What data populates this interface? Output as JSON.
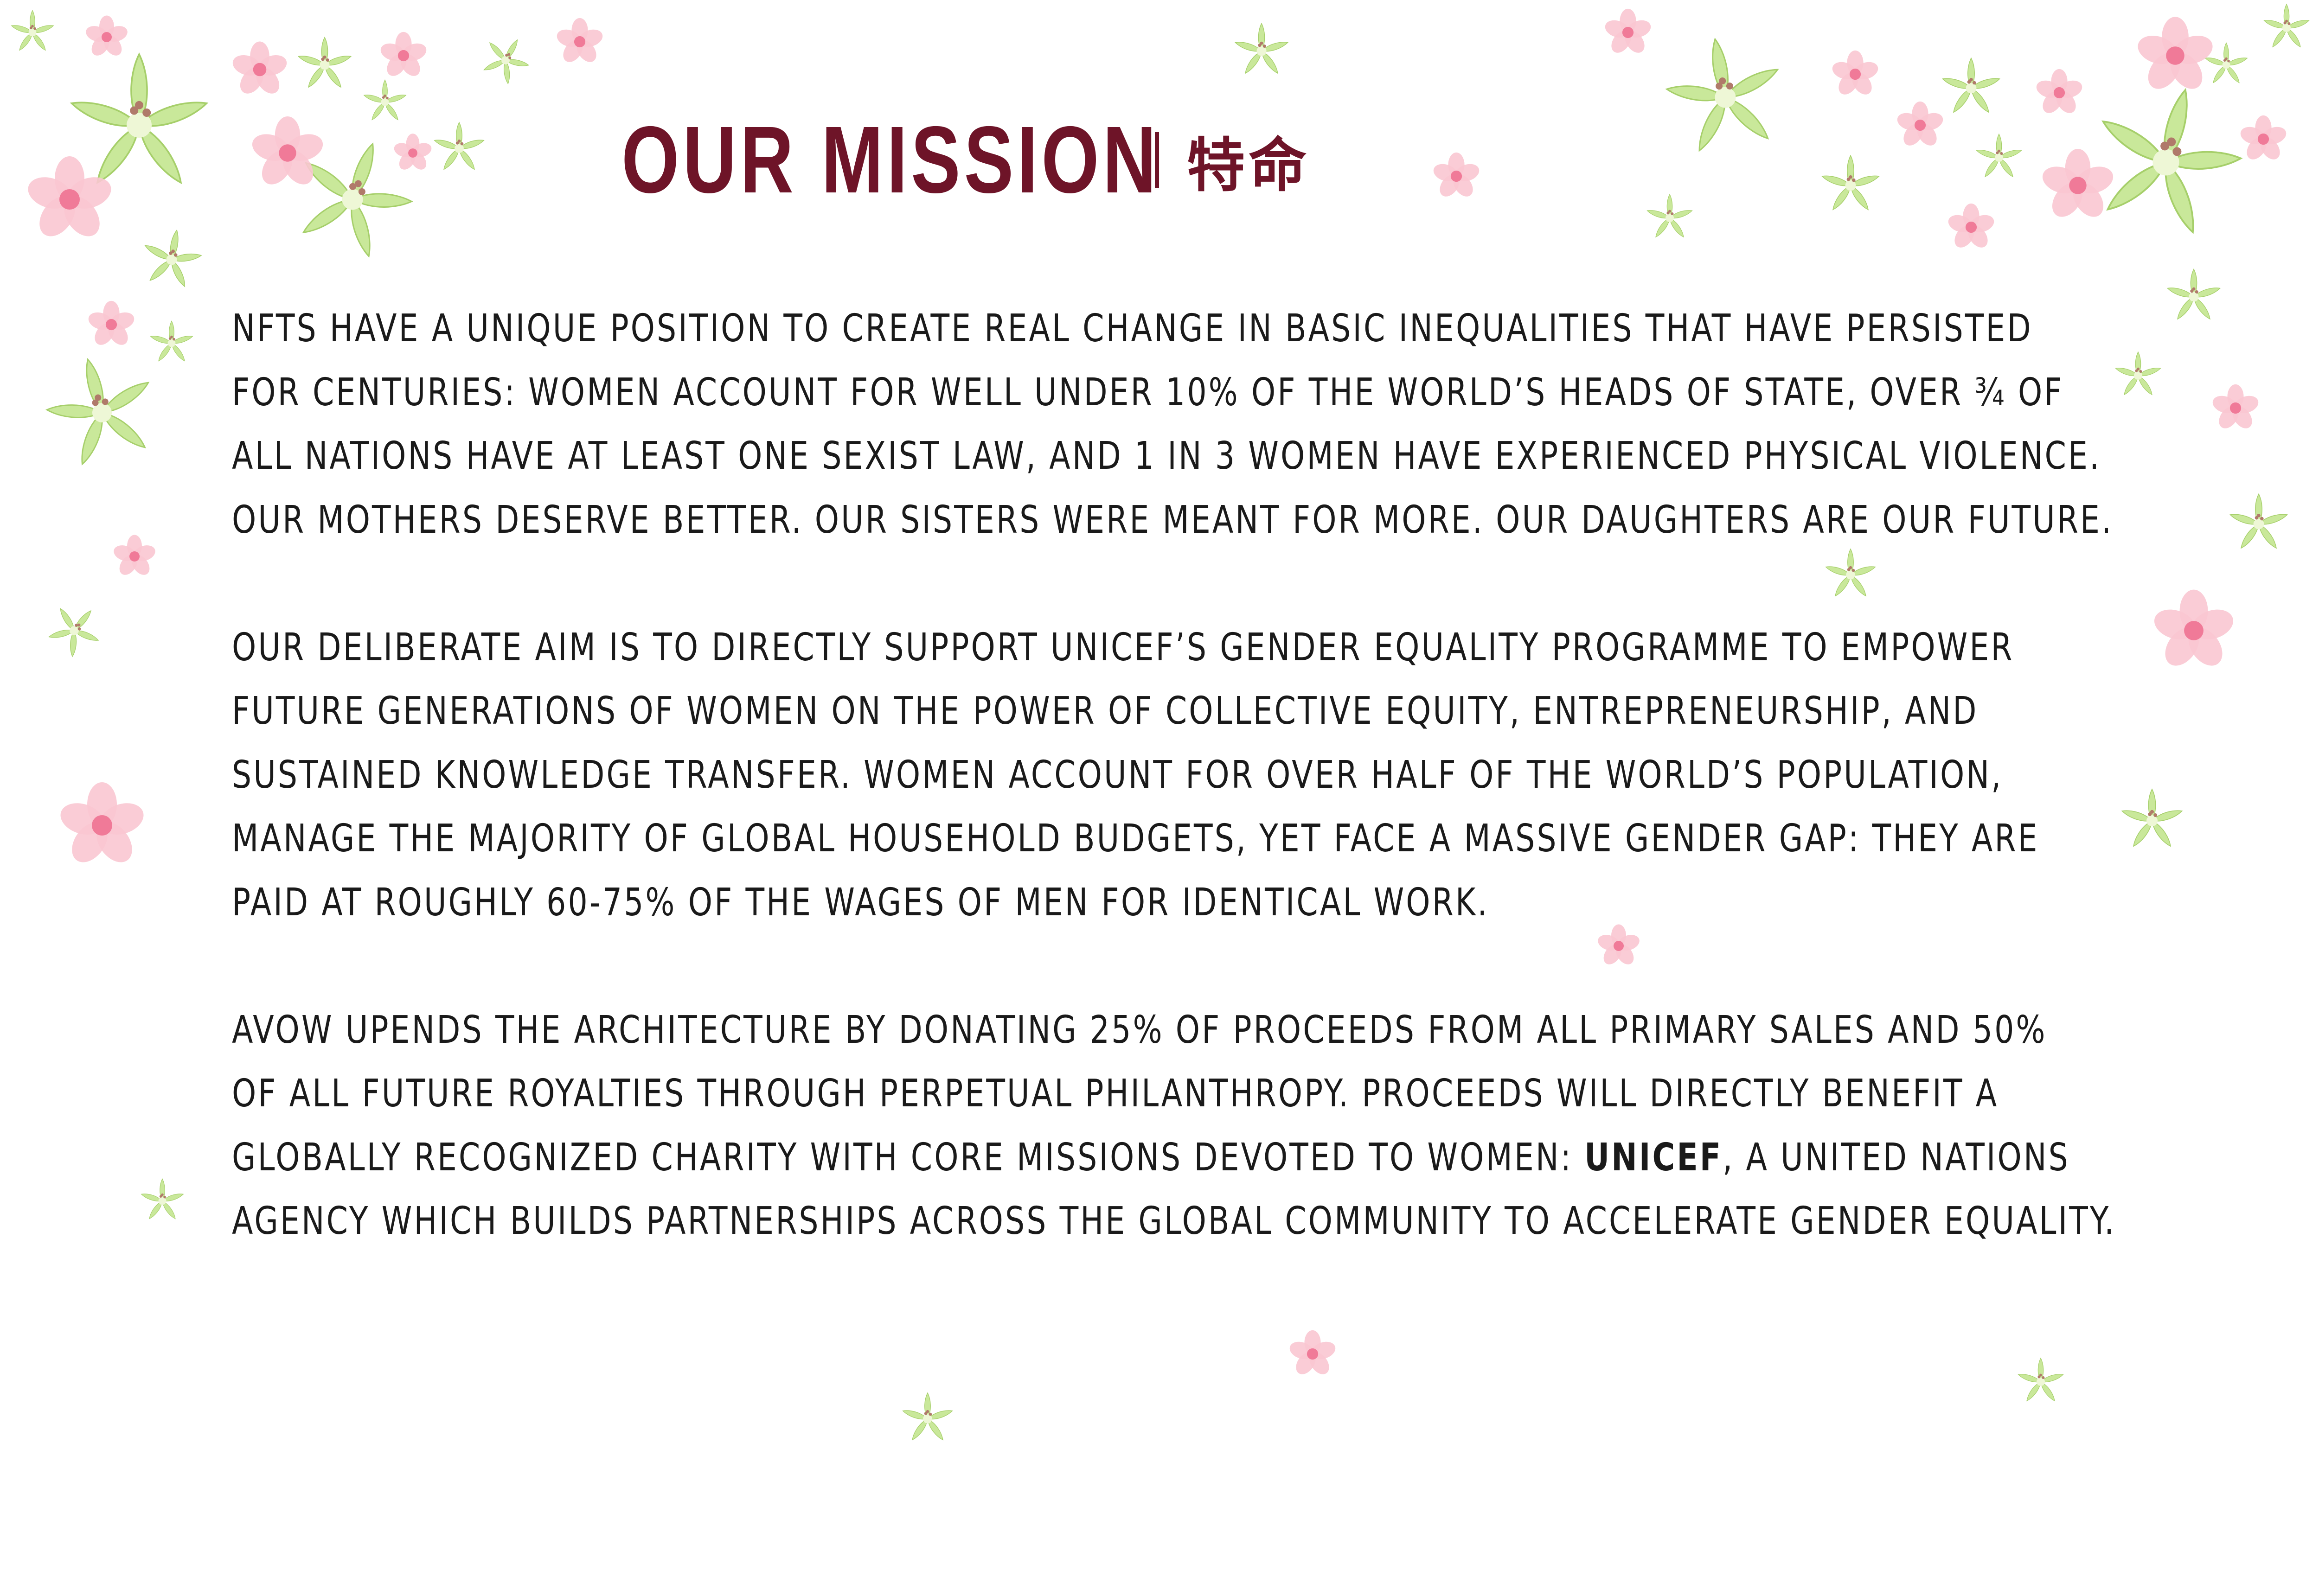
{
  "heading": {
    "title_en": "OUR MISSION",
    "title_zh": "特命"
  },
  "paragraphs": [
    {
      "lines": [
        "NFTS HAVE A UNIQUE POSITION TO CREATE REAL CHANGE IN BASIC INEQUALITIES THAT HAVE PERSISTED",
        "FOR CENTURIES: WOMEN ACCOUNT FOR WELL UNDER 10% OF THE WORLD’S HEADS OF STATE, OVER ¾ OF",
        "ALL NATIONS HAVE AT LEAST ONE SEXIST LAW, AND 1 IN 3 WOMEN HAVE EXPERIENCED PHYSICAL VIOLENCE.",
        "OUR MOTHERS DESERVE BETTER. OUR SISTERS WERE MEANT FOR MORE. OUR DAUGHTERS ARE OUR FUTURE."
      ]
    },
    {
      "lines": [
        "OUR DELIBERATE AIM IS TO DIRECTLY SUPPORT UNICEF’S GENDER EQUALITY PROGRAMME TO EMPOWER",
        "FUTURE GENERATIONS OF WOMEN ON THE POWER OF COLLECTIVE EQUITY, ENTREPRENEURSHIP, AND",
        "SUSTAINED KNOWLEDGE TRANSFER. WOMEN ACCOUNT FOR OVER HALF OF THE WORLD’S POPULATION,",
        "MANAGE THE MAJORITY OF GLOBAL HOUSEHOLD BUDGETS, YET FACE A MASSIVE GENDER GAP: THEY ARE",
        "PAID AT ROUGHLY 60-75% OF THE WAGES OF MEN FOR IDENTICAL WORK."
      ]
    },
    {
      "lines": [
        "AVOW UPENDS THE ARCHITECTURE BY DONATING 25% OF PROCEEDS FROM ALL PRIMARY SALES AND 50%",
        "OF ALL FUTURE ROYALTIES THROUGH PERPETUAL PHILANTHROPY. PROCEEDS WILL DIRECTLY BENEFIT A"
      ],
      "mixed_line": {
        "before": "GLOBALLY RECOGNIZED CHARITY WITH CORE MISSIONS DEVOTED TO WOMEN: ",
        "bold": "UNICEF",
        "after": ", A UNITED NATIONS"
      },
      "last_line": "AGENCY WHICH BUILDS PARTNERSHIPS ACROSS THE GLOBAL COMMUNITY TO ACCELERATE GENDER EQUALITY."
    }
  ],
  "colors": {
    "heading": "#6e1428",
    "text": "#1a1a1a",
    "lily_petal": "#c9e89a",
    "lily_center": "#eef7d6",
    "blossom_petal": "#f9c6d2",
    "blossom_center": "#f07a98"
  },
  "decorations": {
    "lily_icon": "green-lily-flower",
    "blossom_icon": "pink-cherry-blossom"
  }
}
